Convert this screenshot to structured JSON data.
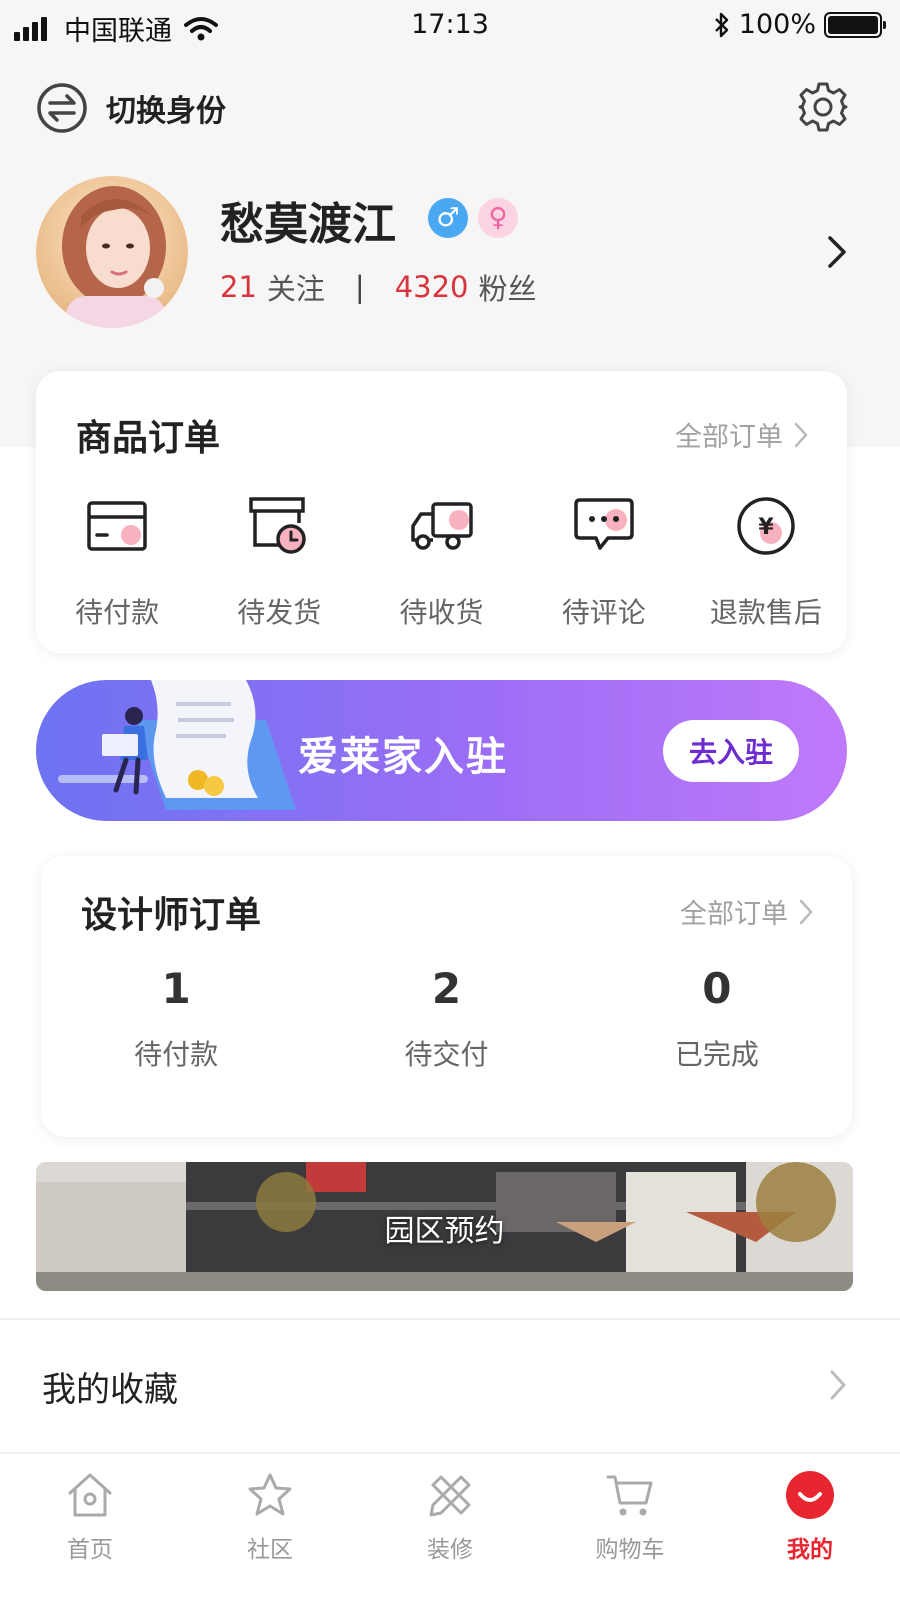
{
  "status_bar": {
    "carrier": "中国联通",
    "time": "17:13",
    "battery": "100%"
  },
  "header": {
    "switch_label": "切换身份"
  },
  "profile": {
    "name": "愁莫渡江",
    "male_symbol": "♂",
    "female_symbol": "♀",
    "follow_count": "21",
    "follow_label": "关注",
    "separator": "|",
    "fans_count": "4320",
    "fans_label": "粉丝"
  },
  "goods_orders": {
    "title": "商品订单",
    "all_label": "全部订单",
    "items": [
      {
        "label": "待付款",
        "icon": "card-icon"
      },
      {
        "label": "待发货",
        "icon": "box-clock-icon"
      },
      {
        "label": "待收货",
        "icon": "truck-icon"
      },
      {
        "label": "待评论",
        "icon": "chat-icon"
      },
      {
        "label": "退款售后",
        "icon": "yen-icon"
      }
    ]
  },
  "banner": {
    "title": "爱莱家入驻",
    "button": "去入驻"
  },
  "designer_orders": {
    "title": "设计师订单",
    "all_label": "全部订单",
    "items": [
      {
        "count": "1",
        "label": "待付款"
      },
      {
        "count": "2",
        "label": "待交付"
      },
      {
        "count": "0",
        "label": "已完成"
      }
    ]
  },
  "park": {
    "label": "园区预约"
  },
  "favorites": {
    "label": "我的收藏"
  },
  "tabbar": {
    "items": [
      {
        "label": "首页",
        "icon": "home-icon"
      },
      {
        "label": "社区",
        "icon": "star-icon"
      },
      {
        "label": "装修",
        "icon": "ruler-pencil-icon"
      },
      {
        "label": "购物车",
        "icon": "cart-icon"
      },
      {
        "label": "我的",
        "icon": "smile-icon"
      }
    ],
    "active": "我的"
  },
  "colors": {
    "accent_red": "#d9343c",
    "tab_active": "#e8262f",
    "banner_start": "#6d73f2",
    "banner_end": "#c079fb",
    "banner_button_text": "#6e2bd0"
  }
}
